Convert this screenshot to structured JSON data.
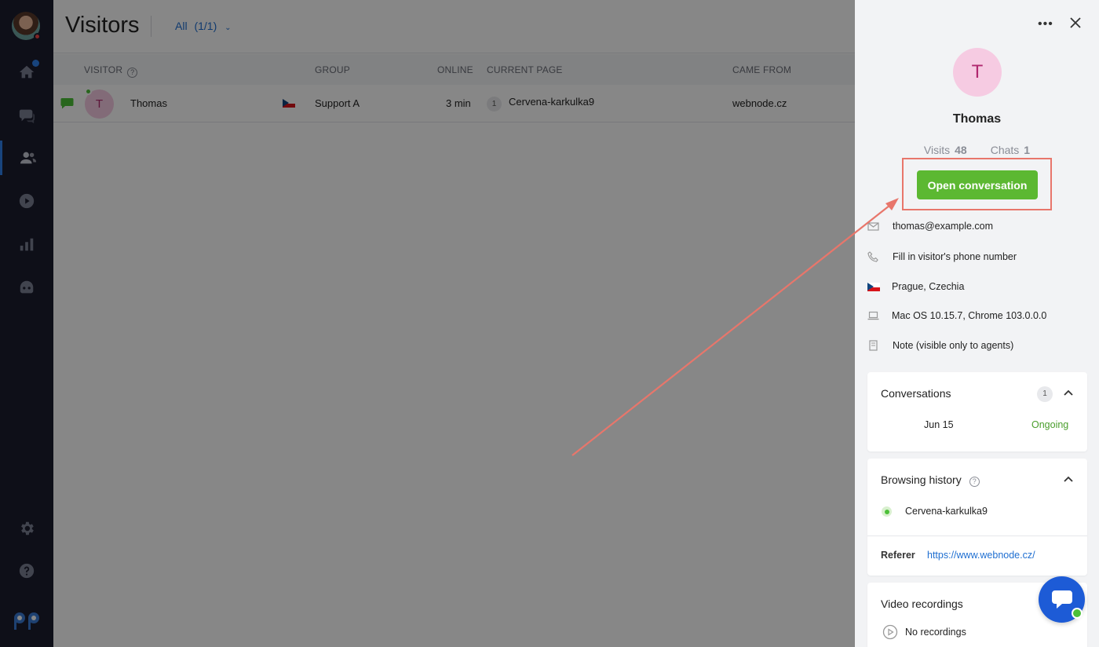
{
  "sidebar": {
    "items": [
      {
        "name": "home-icon"
      },
      {
        "name": "chat-icon"
      },
      {
        "name": "visitors-icon"
      },
      {
        "name": "play-icon"
      },
      {
        "name": "stats-icon"
      },
      {
        "name": "bot-icon"
      }
    ],
    "bottom": [
      {
        "name": "settings-icon"
      },
      {
        "name": "help-icon"
      }
    ]
  },
  "header": {
    "title": "Visitors",
    "filter_label": "All",
    "filter_count": "(1/1)"
  },
  "table": {
    "columns": {
      "visitor": "VISITOR",
      "group": "GROUP",
      "online": "ONLINE",
      "current_page": "CURRENT PAGE",
      "came_from": "CAME FROM"
    },
    "rows": [
      {
        "initial": "T",
        "name": "Thomas",
        "group": "Support A",
        "online": "3 min",
        "page_count": "1",
        "current_page": "Cervena-karkulka9",
        "came_from": "webnode.cz"
      }
    ]
  },
  "panel": {
    "more_label": "•••",
    "initial": "T",
    "name": "Thomas",
    "visits_label": "Visits",
    "visits_value": "48",
    "chats_label": "Chats",
    "chats_value": "1",
    "open_button": "Open conversation",
    "email": "thomas@example.com",
    "phone_placeholder": "Fill in visitor's phone number",
    "location": "Prague, Czechia",
    "device": "Mac OS 10.15.7, Chrome 103.0.0.0",
    "note_placeholder": "Note (visible only to agents)",
    "conversations": {
      "title": "Conversations",
      "count": "1",
      "items": [
        {
          "date": "Jun 15",
          "status": "Ongoing"
        }
      ]
    },
    "browsing": {
      "title": "Browsing history",
      "pages": [
        "Cervena-karkulka9"
      ],
      "referer_label": "Referer",
      "referer_url": "https://www.webnode.cz/"
    },
    "recordings": {
      "title": "Video recordings",
      "empty": "No recordings"
    }
  },
  "colors": {
    "sidebar_bg": "#1b1d2e",
    "accent_blue": "#1f6fd1",
    "button_green": "#5cb832",
    "status_green": "#4a9e2c",
    "annotation_red": "#e8766b",
    "avatar_pink": "#f6cbe2"
  }
}
